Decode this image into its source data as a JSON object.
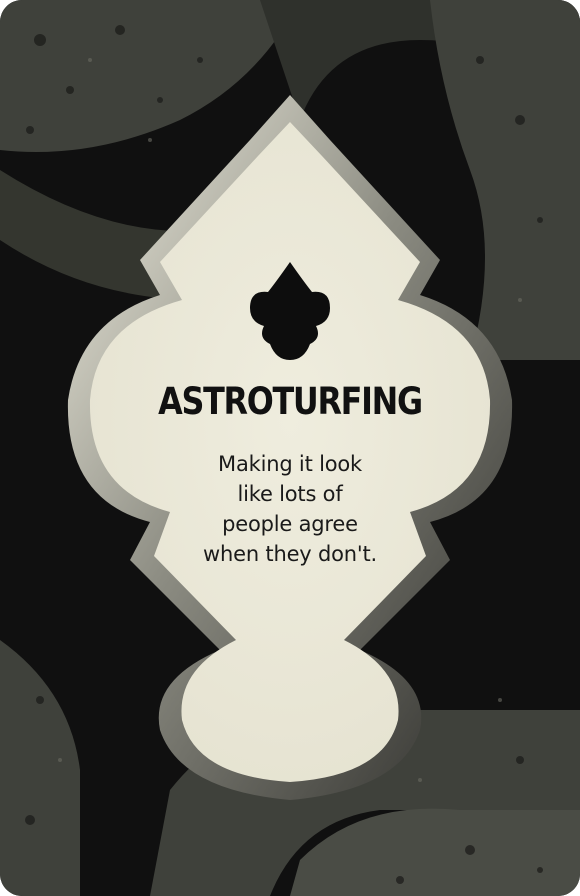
{
  "card": {
    "title": "ASTROTURFING",
    "description_lines": [
      "Making it look",
      "like lots of",
      "people agree",
      "when they don't."
    ],
    "emblem_icon": "spade-drop-icon"
  },
  "colors": {
    "background_dark": "#101010",
    "background_shape": "#3f413b",
    "panel_fill": "#eceadb",
    "ink": "#111111"
  }
}
